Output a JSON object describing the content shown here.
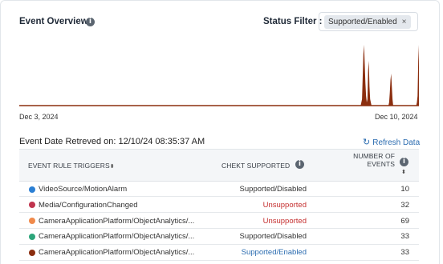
{
  "header": {
    "title": "Event Overview",
    "filter_label": "Status Filter :",
    "filter_chip": "Supported/Enabled",
    "chip_remove": "×"
  },
  "chart": {
    "start_date": "Dec 3, 2024",
    "end_date": "Dec 10, 2024",
    "fill_color": "#8b2e0f"
  },
  "chart_data": {
    "type": "area",
    "title": "",
    "xlabel": "",
    "ylabel": "",
    "x_range": [
      "Dec 3, 2024",
      "Dec 10, 2024"
    ],
    "series": [
      {
        "values": [
          0,
          0,
          0,
          0,
          0,
          0,
          0,
          0,
          0,
          0,
          0,
          0,
          0,
          0,
          0,
          0,
          0,
          0,
          0,
          0,
          0,
          0,
          0,
          0,
          0,
          0,
          0,
          0,
          0,
          0,
          0,
          0,
          0,
          0,
          0,
          0,
          0,
          0,
          0,
          0,
          0,
          0,
          0,
          0,
          0,
          0,
          0,
          0,
          0,
          0,
          0,
          0,
          0,
          0,
          0,
          0,
          0,
          0,
          0,
          0,
          0,
          0,
          0,
          0,
          0,
          0,
          0,
          0,
          0,
          0,
          0,
          0,
          0,
          0,
          0,
          0,
          0,
          0,
          0,
          0,
          0,
          0,
          0,
          0,
          0,
          0,
          0,
          0,
          0,
          0,
          0,
          0,
          0,
          0,
          0,
          0,
          0,
          0,
          0,
          0,
          0,
          0,
          0,
          0,
          0,
          0,
          0,
          0,
          0,
          0,
          0,
          0,
          0,
          0,
          0,
          0,
          0,
          0,
          0,
          0,
          0,
          0,
          0,
          0,
          0,
          0,
          0,
          0,
          0,
          0,
          0,
          0,
          0,
          0,
          0,
          0,
          0,
          0,
          0,
          0,
          0,
          0,
          0,
          0,
          0,
          0,
          0,
          0,
          0,
          0,
          0,
          0,
          0,
          0,
          0,
          0,
          0,
          0,
          0,
          0,
          0,
          0,
          0,
          0,
          0,
          0,
          0,
          0,
          0,
          0,
          0,
          0,
          0,
          0,
          0,
          0,
          0,
          0,
          0,
          0,
          0,
          0,
          0,
          0,
          0,
          0,
          0,
          0,
          0,
          0,
          0,
          0,
          0,
          0,
          0,
          0,
          0,
          0,
          0,
          0,
          0,
          0,
          0,
          0,
          0,
          0,
          0,
          0,
          0,
          0,
          0,
          0,
          0,
          0,
          0,
          0,
          0,
          0,
          0,
          0,
          0,
          0,
          0,
          0,
          0,
          0,
          0,
          0,
          0,
          0,
          0,
          0,
          0,
          0,
          0,
          0,
          0,
          0,
          0,
          0,
          0,
          0,
          0,
          0,
          0,
          0,
          0,
          0,
          0,
          0,
          0,
          0,
          0,
          0,
          0,
          0,
          0,
          0,
          0,
          0,
          0,
          0,
          0,
          0,
          0,
          0,
          0,
          0,
          0,
          0,
          0,
          0,
          0,
          0,
          0,
          0,
          0,
          0,
          0,
          0,
          0,
          0,
          0,
          0,
          0,
          0,
          0,
          0,
          0,
          0,
          0,
          0,
          0,
          0,
          0,
          0,
          0,
          0,
          0,
          0,
          0,
          0,
          0,
          0,
          0,
          0,
          0,
          0,
          0,
          0,
          0,
          0,
          0,
          0,
          0,
          0,
          0,
          0,
          0,
          0,
          0,
          0,
          0,
          0,
          0,
          0,
          0,
          0,
          0,
          0,
          0,
          0,
          0,
          0,
          0,
          0,
          0,
          0,
          0,
          0,
          0,
          0,
          0,
          0,
          0,
          0,
          0,
          0,
          0,
          0,
          0,
          0,
          0,
          0,
          0,
          0,
          0,
          0,
          0,
          0,
          0,
          0,
          0,
          0,
          0,
          0,
          0,
          0,
          0,
          0,
          0,
          0,
          0,
          0,
          0,
          0,
          0,
          0,
          0,
          0,
          0,
          0,
          0,
          0,
          0,
          0,
          0,
          0,
          0,
          0,
          0,
          0,
          0,
          0,
          0,
          0,
          0,
          0,
          0,
          0,
          0,
          0,
          0,
          0,
          0,
          0,
          0,
          0,
          0,
          0,
          0,
          0,
          0,
          0,
          0,
          0,
          0,
          0,
          0,
          0,
          0,
          0,
          0,
          0,
          0,
          0,
          0,
          0,
          0,
          0,
          0,
          0,
          0,
          0,
          0,
          0,
          0,
          0,
          0,
          0,
          0,
          0,
          0,
          0,
          0,
          0,
          0,
          0,
          0,
          0,
          0,
          0,
          0,
          0,
          0,
          0,
          0,
          0,
          0,
          0,
          0,
          0,
          0,
          0,
          0,
          0,
          0,
          0,
          0,
          0,
          0,
          0,
          0,
          0,
          0,
          0,
          0,
          0,
          0,
          0,
          0,
          0,
          0,
          0,
          0,
          0,
          0,
          0,
          0,
          0,
          0,
          0,
          0,
          0,
          0,
          0,
          0,
          0,
          0,
          0,
          0,
          0,
          0,
          0,
          0,
          1,
          2,
          9,
          16,
          19,
          13,
          7,
          3,
          1,
          2,
          11,
          14,
          6,
          2,
          1,
          0,
          0,
          0,
          0,
          0,
          0,
          0,
          0,
          0,
          0,
          0,
          0,
          0,
          0,
          0,
          0,
          0,
          0,
          0,
          0,
          0,
          0,
          0,
          0,
          0,
          0,
          1,
          4,
          8,
          10,
          6,
          2,
          0,
          0,
          0,
          0,
          0,
          0,
          0,
          0,
          0,
          0,
          0,
          0,
          0,
          0,
          0,
          0,
          0,
          0,
          0,
          0,
          0,
          0,
          0,
          0,
          0,
          0,
          0,
          0,
          0,
          0,
          0,
          0,
          0,
          0,
          0,
          1,
          3,
          14,
          19
        ]
      }
    ],
    "grid": false,
    "legend": "none"
  },
  "table": {
    "retrieved": "Event Date Retreved on: 12/10/24 08:35:37 AM",
    "refresh_label": "Refresh Data",
    "col1": "EVENT RULE TRIGGERS",
    "col2": "CHEKT SUPPORTED",
    "col3_line1": "NUMBER OF",
    "col3_line2": "EVENTS",
    "sort_glyph": "⬍",
    "rows": [
      {
        "name": "VideoSource/MotionAlarm",
        "status": "Supported/Disabled",
        "status_color": "#333333",
        "dot_color": "#2b7fd4",
        "count": "10"
      },
      {
        "name": "Media/ConfigurationChanged",
        "status": "Unsupported",
        "status_color": "#c53030",
        "dot_color": "#c0344e",
        "count": "32"
      },
      {
        "name": "CameraApplicationPlatform/ObjectAnalytics/...",
        "status": "Unsupported",
        "status_color": "#c53030",
        "dot_color": "#f08a4b",
        "count": "69"
      },
      {
        "name": "CameraApplicationPlatform/ObjectAnalytics/...",
        "status": "Supported/Disabled",
        "status_color": "#333333",
        "dot_color": "#2ca57a",
        "count": "33"
      },
      {
        "name": "CameraApplicationPlatform/ObjectAnalytics/...",
        "status": "Supported/Enabled",
        "status_color": "#2b6cb0",
        "dot_color": "#8b2e0f",
        "count": "33"
      }
    ]
  }
}
